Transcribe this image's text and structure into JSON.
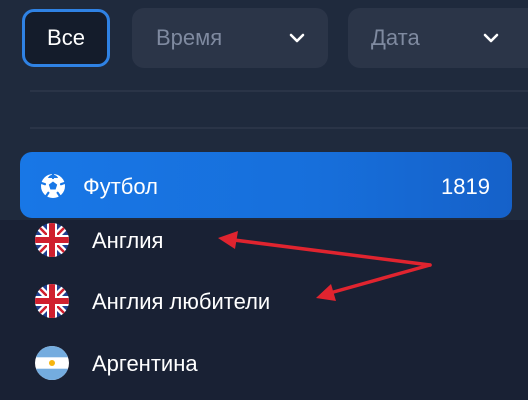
{
  "filters": {
    "all_label": "Все",
    "time_label": "Время",
    "date_label": "Дата"
  },
  "sport": {
    "label": "Футбол",
    "count": "1819"
  },
  "countries": [
    {
      "label": "Англия",
      "flag": "england-flag-icon"
    },
    {
      "label": "Англия любители",
      "flag": "england-flag-icon"
    },
    {
      "label": "Аргентина",
      "flag": "argentina-flag-icon"
    }
  ],
  "colors": {
    "accent": "#1877e6",
    "annotation_arrow": "#e0242f",
    "background": "#1f2a3d"
  }
}
